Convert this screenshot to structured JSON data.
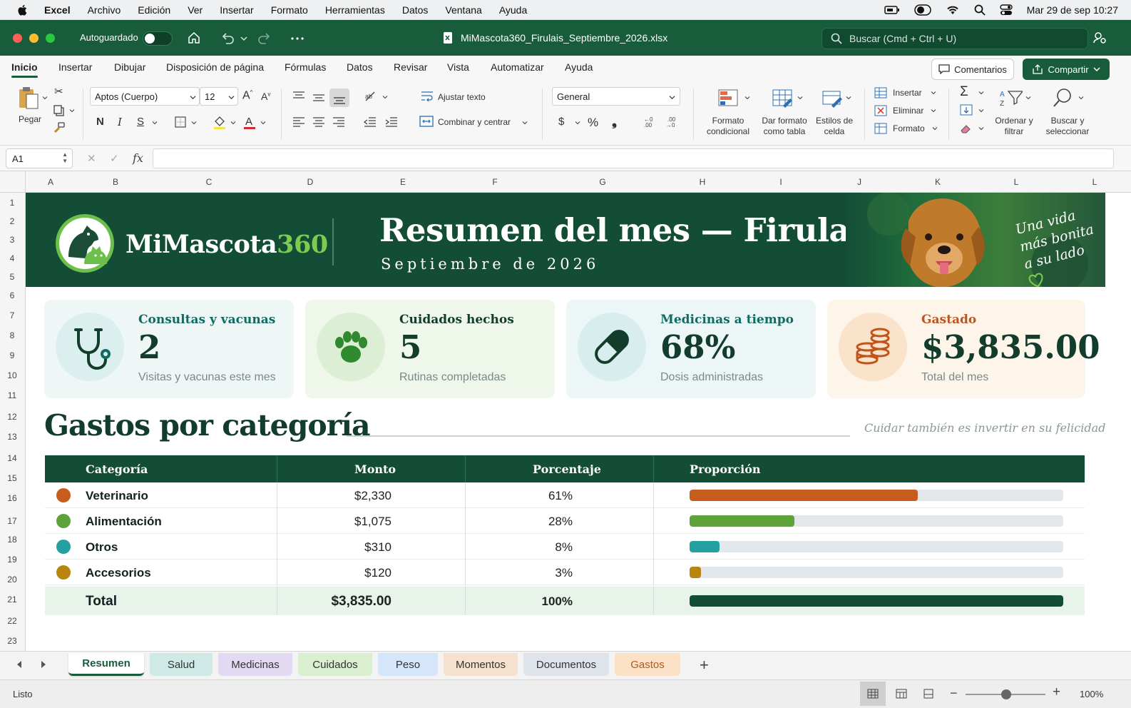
{
  "menubar": {
    "app": "Excel",
    "items": [
      "Archivo",
      "Edición",
      "Ver",
      "Insertar",
      "Formato",
      "Herramientas",
      "Datos",
      "Ventana",
      "Ayuda"
    ],
    "datetime": "Mar 29 de sep  10:27"
  },
  "titlebar": {
    "autosave_label": "Autoguardado",
    "autosave_state": "off",
    "filename": "MiMascota360_Firulais_Septiembre_2026.xlsx",
    "search_placeholder": "Buscar (Cmd + Ctrl + U)"
  },
  "ribbon_tabs": [
    "Inicio",
    "Insertar",
    "Dibujar",
    "Disposición de página",
    "Fórmulas",
    "Datos",
    "Revisar",
    "Vista",
    "Automatizar",
    "Ayuda"
  ],
  "active_tab": "Inicio",
  "comments_label": "Comentarios",
  "share_label": "Compartir",
  "ribbon": {
    "paste_label": "Pegar",
    "font_name": "Aptos (Cuerpo)",
    "font_size": "12",
    "bold": "N",
    "italic": "I",
    "underline": "S",
    "wrap_text": "Ajustar texto",
    "merge_center": "Combinar y centrar",
    "number_format": "General",
    "currency": "$",
    "percent": "%",
    "comma": "❟",
    "cond_format": "Formato condicional",
    "format_table": "Dar formato como tabla",
    "cell_styles": "Estilos de celda",
    "insert": "Insertar",
    "delete": "Eliminar",
    "format": "Formato",
    "sort_filter": "Ordenar y filtrar",
    "find_select": "Buscar y seleccionar"
  },
  "formula_bar": {
    "name_box": "A1",
    "formula": ""
  },
  "columns": [
    "A",
    "B",
    "C",
    "D",
    "E",
    "F",
    "G",
    "H",
    "I",
    "J",
    "K",
    "L",
    "L"
  ],
  "rows": [
    "1",
    "2",
    "3",
    "4",
    "5",
    "6",
    "7",
    "8",
    "9",
    "10",
    "11",
    "12",
    "13",
    "14",
    "15",
    "16",
    "17",
    "18",
    "19",
    "20",
    "21",
    "22",
    "23"
  ],
  "banner": {
    "brand_main": "MiMascota",
    "brand_num": "360",
    "title": "Resumen del mes — Firulais",
    "subtitle": "Septiembre de 2026",
    "tagline_1": "Una vida",
    "tagline_2": "más bonita",
    "tagline_3": "a su lado"
  },
  "kpis": [
    {
      "label": "Consultas y vacunas",
      "value": "2",
      "sub": "Visitas y vacunas este mes",
      "icon": "stethoscope-icon",
      "color": "#0f6b63",
      "bg": "#eef6f6",
      "circle": "#dcefef"
    },
    {
      "label": "Cuidados hechos",
      "value": "5",
      "sub": "Rutinas completadas",
      "icon": "paw-icon",
      "color": "#123c2c",
      "bg": "#eef7ea",
      "circle": "#dcefd5"
    },
    {
      "label": "Medicinas a tiempo",
      "value": "68%",
      "sub": "Dosis administradas",
      "icon": "pill-icon",
      "color": "#0f6b63",
      "bg": "#ecf6f6",
      "circle": "#d8eeee"
    },
    {
      "label": "Gastado",
      "value": "$3,835.00",
      "sub": "Total del mes",
      "icon": "coins-icon",
      "color": "#c2541a",
      "bg": "#fdf5ea",
      "circle": "#fbe3cb"
    }
  ],
  "section": {
    "title": "Gastos por categoría",
    "note": "Cuidar también es invertir en su felicidad"
  },
  "table": {
    "headers": [
      "Categoría",
      "Monto",
      "Porcentaje",
      "Proporción"
    ],
    "rows": [
      {
        "category": "Veterinario",
        "amount": "$2,330",
        "percent": "61%",
        "share": 0.61,
        "color": "#c75d1c"
      },
      {
        "category": "Alimentación",
        "amount": "$1,075",
        "percent": "28%",
        "share": 0.28,
        "color": "#5ea33a"
      },
      {
        "category": "Otros",
        "amount": "$310",
        "percent": "8%",
        "share": 0.08,
        "color": "#24a0a0"
      },
      {
        "category": "Accesorios",
        "amount": "$120",
        "percent": "3%",
        "share": 0.03,
        "color": "#b8860f"
      }
    ],
    "total": {
      "label": "Total",
      "amount": "$3,835.00",
      "percent": "100%",
      "share": 1.0,
      "color": "#134d36"
    }
  },
  "sheet_tabs": [
    {
      "label": "Resumen",
      "bg": "#ffffff",
      "active": true
    },
    {
      "label": "Salud",
      "bg": "#cfe9e6"
    },
    {
      "label": "Medicinas",
      "bg": "#e4d9f3"
    },
    {
      "label": "Cuidados",
      "bg": "#d9efcf"
    },
    {
      "label": "Peso",
      "bg": "#d5e6fa"
    },
    {
      "label": "Momentos",
      "bg": "#f6e1cf"
    },
    {
      "label": "Documentos",
      "bg": "#dfe4ea"
    },
    {
      "label": "Gastos",
      "bg": "#fbe2c6"
    }
  ],
  "status": {
    "ready": "Listo",
    "zoom": "100%"
  }
}
